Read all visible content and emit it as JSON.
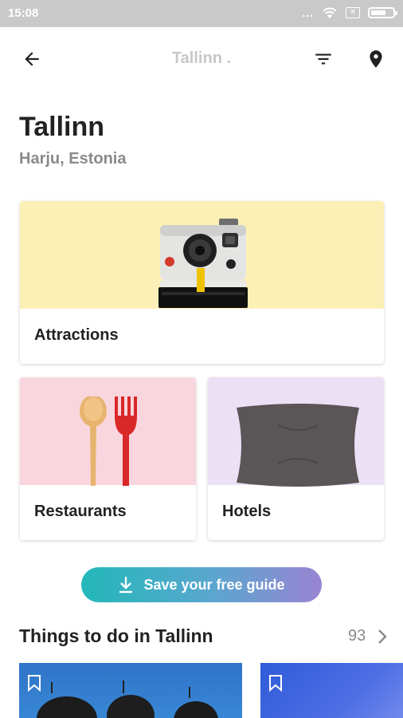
{
  "status_bar": {
    "time": "15:08",
    "dots": "...",
    "x_icon": "✕"
  },
  "app_bar": {
    "title": "Tallinn ."
  },
  "header": {
    "city": "Tallinn",
    "region": "Harju, Estonia"
  },
  "categories": [
    {
      "label": "Attractions",
      "icon": "camera-image",
      "color": "#fdf0b6"
    },
    {
      "label": "Restaurants",
      "icon": "spoon-fork-image",
      "color": "#f9d6de"
    },
    {
      "label": "Hotels",
      "icon": "pillow-image",
      "color": "#ece0f5"
    }
  ],
  "save_guide": {
    "label": "Save your free guide",
    "gradient": [
      "#22b8b9",
      "#9a84d2"
    ]
  },
  "things_to_do": {
    "title": "Things to do in Tallinn",
    "count": "93"
  }
}
